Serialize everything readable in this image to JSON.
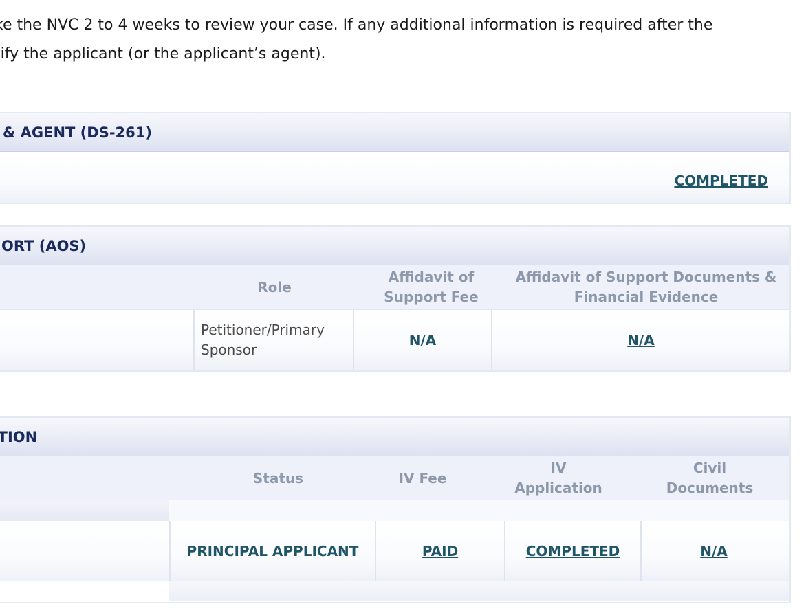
{
  "intro": {
    "line1": "ke the NVC 2 to 4 weeks to review your case. If any additional information is required after the",
    "line2": "tify the applicant (or the applicant’s agent)."
  },
  "ds261": {
    "title": "& AGENT (DS-261)",
    "status": "COMPLETED"
  },
  "aos": {
    "title": "ORT (AOS)",
    "headers": {
      "role": "Role",
      "fee": "Affidavit of Support Fee",
      "docs": "Affidavit of Support Documents & Financial Evidence"
    },
    "row": {
      "role": "Petitioner/Primary Sponsor",
      "fee": "N/A",
      "docs": "N/A"
    }
  },
  "application": {
    "title": "ATION",
    "headers": {
      "status": "Status",
      "fee": "IV Fee",
      "app": "IV Application",
      "civil": "Civil Documents"
    },
    "row": {
      "status": "PRINCIPAL APPLICANT",
      "fee": "PAID",
      "app": "COMPLETED",
      "civil": "N/A"
    }
  },
  "colors": {
    "link": "#1f5566",
    "header_text": "#1b2a5c",
    "column_header": "#8d99ab"
  }
}
